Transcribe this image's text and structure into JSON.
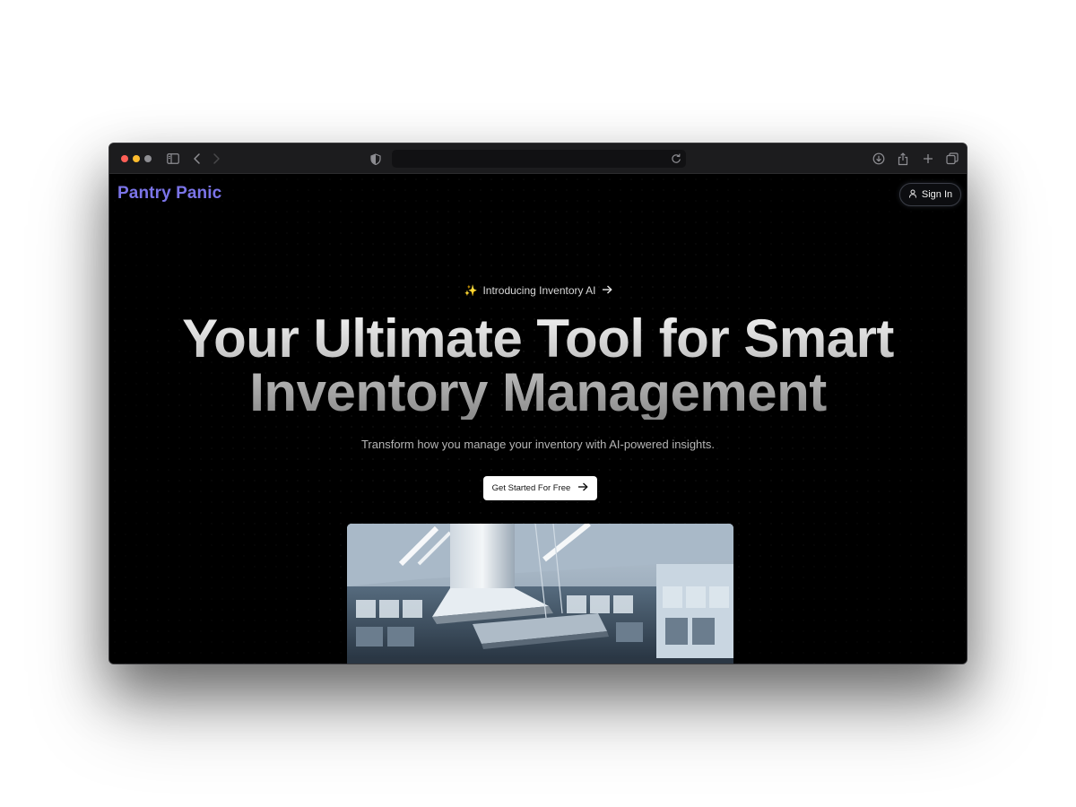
{
  "browser": {
    "icons": [
      "sidebar-icon",
      "back-icon",
      "forward-icon",
      "shield-icon",
      "reload-icon",
      "download-icon",
      "share-icon",
      "new-tab-icon",
      "tabs-overview-icon"
    ]
  },
  "nav": {
    "brand": "Pantry Panic",
    "signin_label": "Sign In",
    "brand_color": "#7b74e8"
  },
  "hero": {
    "badge_emoji": "✨",
    "badge_text": "Introducing Inventory AI",
    "title_line1": "Your Ultimate Tool for Smart",
    "title_line2": "Inventory Management",
    "subtitle": "Transform how you manage your inventory with AI-powered insights.",
    "cta_label": "Get Started For Free"
  }
}
